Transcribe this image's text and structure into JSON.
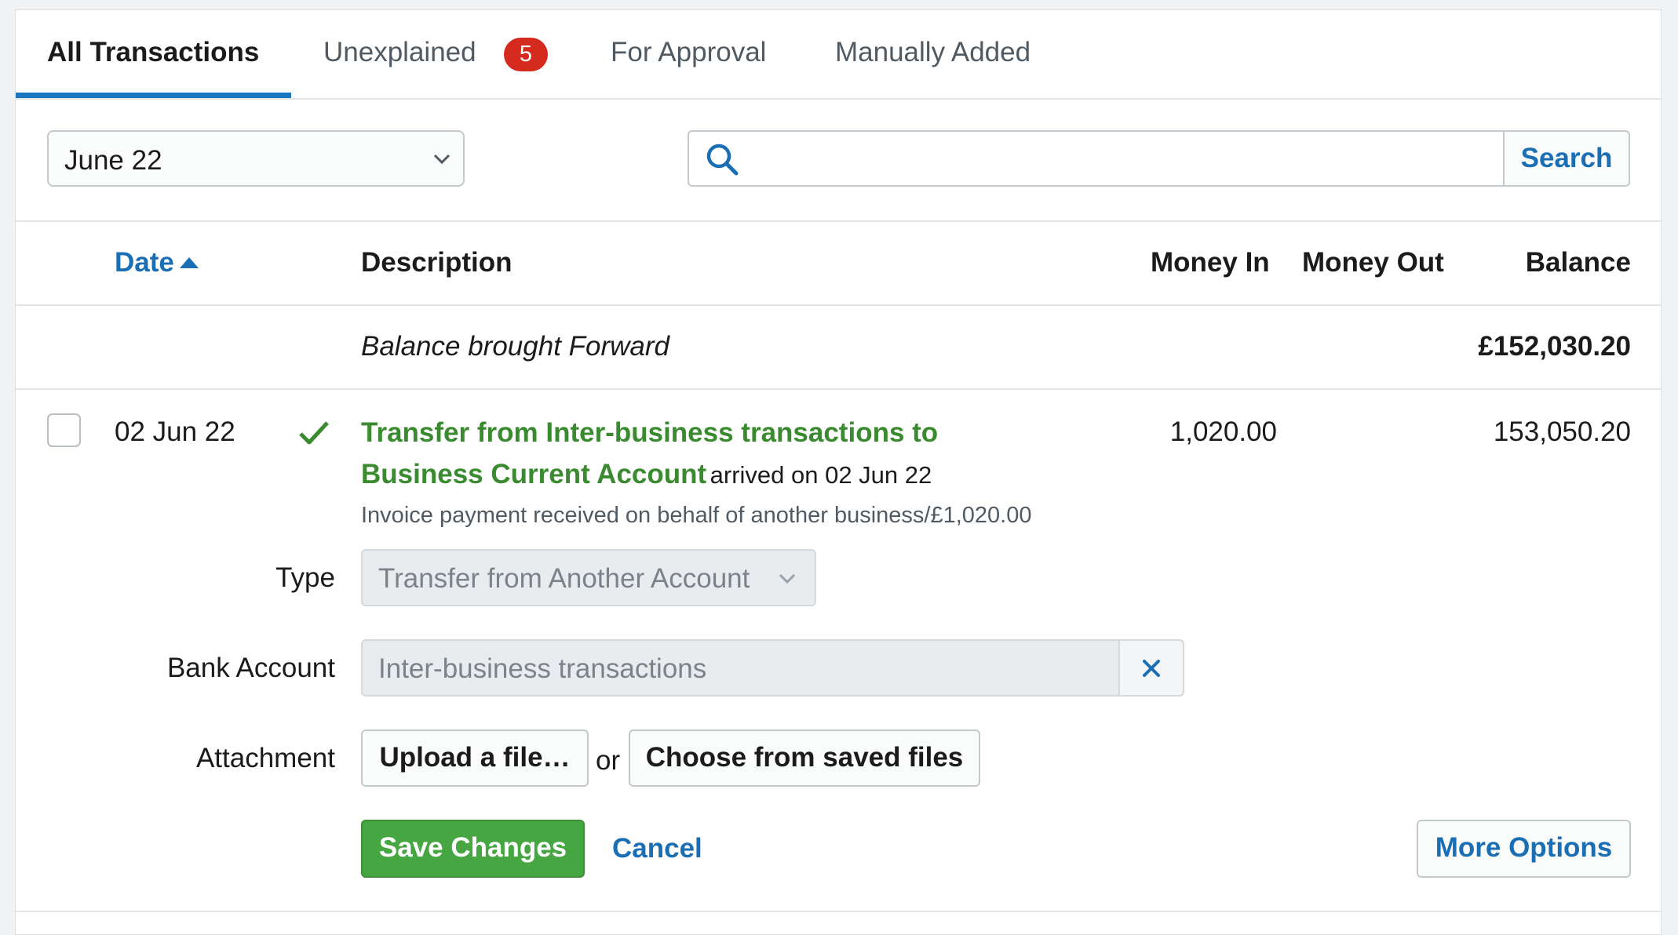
{
  "tabs": [
    {
      "label": "All Transactions",
      "active": true
    },
    {
      "label": "Unexplained",
      "badge": "5"
    },
    {
      "label": "For Approval"
    },
    {
      "label": "Manually Added"
    }
  ],
  "filters": {
    "period_selected": "June 22",
    "search_placeholder": "",
    "search_button": "Search"
  },
  "table": {
    "headers": {
      "date": "Date",
      "description": "Description",
      "money_in": "Money In",
      "money_out": "Money Out",
      "balance": "Balance"
    },
    "sort": {
      "column": "date",
      "direction": "ascending"
    },
    "balance_forward": {
      "label": "Balance brought Forward",
      "amount": "£152,030.20"
    },
    "row": {
      "date": "02 Jun 22",
      "status": "explained",
      "title": "Transfer from Inter-business transactions to Business Current Account",
      "arrived": "arrived on 02 Jun 22",
      "note": "Invoice payment received on behalf of another business/£1,020.00",
      "money_in": "1,020.00",
      "money_out": "",
      "balance": "153,050.20"
    }
  },
  "editor": {
    "type_label": "Type",
    "type_value": "Transfer from Another Account",
    "bank_label": "Bank Account",
    "bank_value": "Inter-business transactions",
    "attachment_label": "Attachment",
    "upload_button": "Upload a file…",
    "or_text": "or",
    "saved_files_button": "Choose from saved files",
    "save_button": "Save Changes",
    "cancel_link": "Cancel",
    "more_options_button": "More Options"
  },
  "colors": {
    "accent_blue": "#1a78c2",
    "link_blue": "#1a6fb4",
    "success_green": "#46a641",
    "badge_red": "#d52a1e"
  }
}
